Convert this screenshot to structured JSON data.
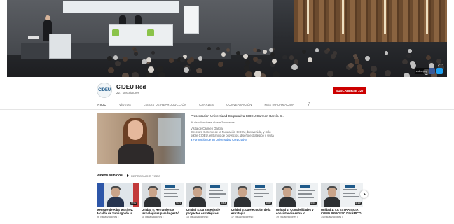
{
  "channel": {
    "name": "CIDEU Red",
    "subscribers": "227 suscriptores",
    "avatar_text": "CIDEU",
    "subscribe_label": "SUSCRIBIRSE 227"
  },
  "tabs": [
    {
      "label": "INICIO",
      "active": true
    },
    {
      "label": "VÍDEOS",
      "active": false
    },
    {
      "label": "LISTAS DE REPRODUCCIÓN",
      "active": false
    },
    {
      "label": "CANALES",
      "active": false
    },
    {
      "label": "CONVERSACIÓN",
      "active": false
    },
    {
      "label": "MÁS INFORMACIÓN",
      "active": false
    }
  ],
  "featured": {
    "title": "Presentación Universidad Corporativa CIDEU Carmen García C...",
    "meta": "96 visualizaciones • Hace 2 semanas",
    "desc_lines": [
      "Visita de Carmen García",
      "Directora Gerente de la Fundación CIDEU, bienvenida, y más",
      "sobre CIDEU, el Banco de proyectos, diseño estratégico y visita",
      "a Formación de su Universidad Corporativa"
    ]
  },
  "uploads": {
    "title": "Vídeos subidos",
    "play_all": "REPRODUCIR TODO",
    "videos": [
      {
        "title": "Mensaje de Alba Martínez, Alcalde de Santiago de la...",
        "views": "96 visualizaciones •",
        "duration": "0:52"
      },
      {
        "title": "Unidad 5: Herramientas tecnológicas para la gestió...",
        "views": "18 visualizaciones •",
        "duration": "6:27"
      },
      {
        "title": "Unidad 4: La síntesis de proyectos estratégicos",
        "views": "15 visualizaciones •",
        "duration": "5:44"
      },
      {
        "title": "Unidad 3: La ejecución de la estrategia",
        "views": "17 visualizaciones •",
        "duration": "5:39"
      },
      {
        "title": "Unidad 2: Complejidades y consistencia entre lo público...",
        "views": "19 visualizaciones •",
        "duration": "6:51"
      },
      {
        "title": "Unidad 1: LA ESTRATEGIA COMO PROCESO DINÁMICO",
        "views": "34 visualizaciones •",
        "duration": "5:19"
      }
    ]
  },
  "banner": {
    "link_label": "cideu.org"
  },
  "icons": {
    "search": "search-icon",
    "next": "chevron-right-icon",
    "play_all": "play-icon"
  },
  "colors": {
    "subscribe": "#cc0000",
    "link": "#065fd4",
    "text_secondary": "#606060"
  }
}
